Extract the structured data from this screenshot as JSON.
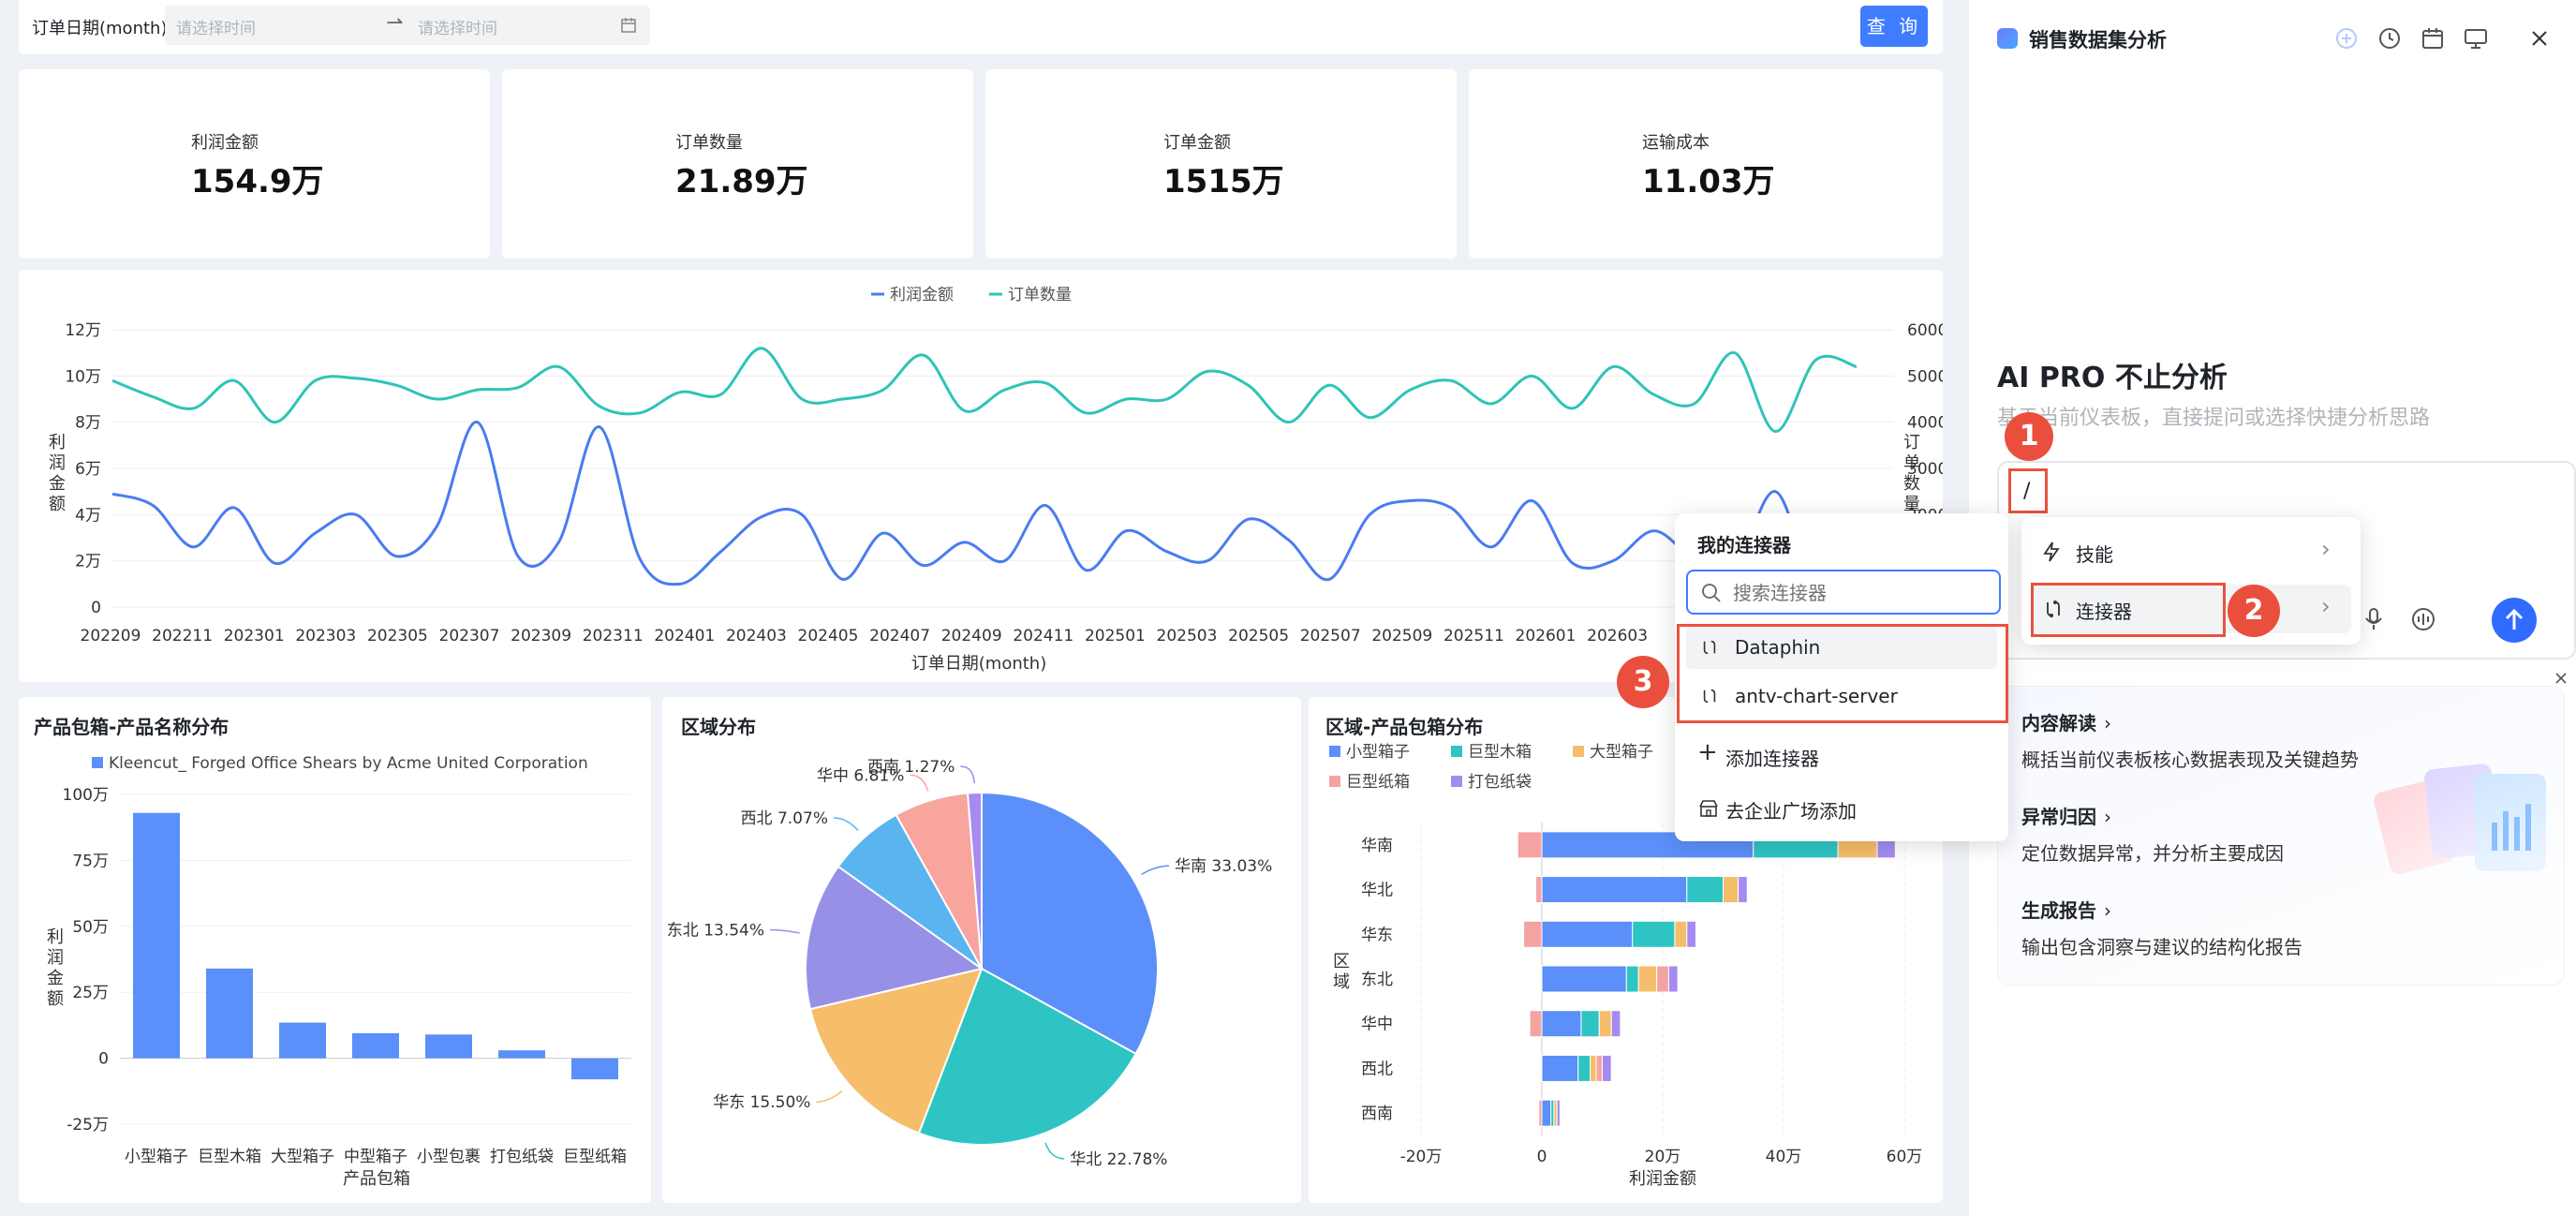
{
  "filter": {
    "label": "订单日期(month)",
    "start_placeholder": "请选择时间",
    "end_placeholder": "请选择时间",
    "query_label": "查 询"
  },
  "kpis": [
    {
      "label": "利润金额",
      "value": "154.9万"
    },
    {
      "label": "订单数量",
      "value": "21.89万"
    },
    {
      "label": "订单金额",
      "value": "1515万"
    },
    {
      "label": "运输成本",
      "value": "11.03万"
    }
  ],
  "line_chart": {
    "legend": [
      "利润金额",
      "订单数量"
    ],
    "y_left_ticks": [
      "12万",
      "10万",
      "8万",
      "6万",
      "4万",
      "2万",
      "0"
    ],
    "y_right_ticks": [
      "6000",
      "5000",
      "4000",
      "3000",
      "2000"
    ],
    "y_left_title": "利润金额",
    "y_right_title": "订单数量",
    "x_title": "订单日期(month)",
    "x_ticks": [
      "202209",
      "202211",
      "202301",
      "202303",
      "202305",
      "202307",
      "202309",
      "202311",
      "202401",
      "202403",
      "202405",
      "202407",
      "202409",
      "202411",
      "202501",
      "202503",
      "202505",
      "202507",
      "202509",
      "202511",
      "202601",
      "202603"
    ]
  },
  "bar_chart": {
    "title": "产品包箱-产品名称分布",
    "legend": "Kleencut_ Forged Office Shears by Acme United Corporation",
    "y_ticks": [
      "100万",
      "75万",
      "50万",
      "25万",
      "0",
      "-25万"
    ],
    "y_title": "利润金额",
    "x_title": "产品包箱"
  },
  "pie_chart": {
    "title": "区域分布"
  },
  "hbar_chart": {
    "title": "区域-产品包箱分布",
    "legend": [
      {
        "name": "小型箱子",
        "color": "#5b8ff9"
      },
      {
        "name": "巨型木箱",
        "color": "#2ec4c4"
      },
      {
        "name": "大型箱子",
        "color": "#f6bd6a"
      },
      {
        "name": "巨型纸箱",
        "color": "#f4a3a3"
      },
      {
        "name": "打包纸袋",
        "color": "#a58bf0"
      }
    ],
    "y_title": "区域",
    "x_title": "利润金额",
    "x_ticks": [
      "-20万",
      "0",
      "20万",
      "40万",
      "60万"
    ]
  },
  "chart_data": [
    {
      "type": "line",
      "x": [
        "202209",
        "202210",
        "202211",
        "202212",
        "202301",
        "202302",
        "202303",
        "202304",
        "202305",
        "202306",
        "202307",
        "202308",
        "202309",
        "202310",
        "202311",
        "202312",
        "202401",
        "202402",
        "202403",
        "202404",
        "202405",
        "202406",
        "202407",
        "202408",
        "202409",
        "202410",
        "202411",
        "202412",
        "202501",
        "202502",
        "202503",
        "202504",
        "202505",
        "202506",
        "202507",
        "202508",
        "202509",
        "202510",
        "202511",
        "202512",
        "202601",
        "202602",
        "202603",
        "202604"
      ],
      "series": [
        {
          "name": "利润金额",
          "axis": "left",
          "color": "#4a7cf0",
          "values": [
            4.9,
            4.4,
            2.6,
            4.3,
            1.9,
            3.2,
            4.0,
            2.2,
            3.5,
            8.0,
            2.2,
            2.8,
            7.8,
            2.1,
            1.0,
            2.4,
            3.9,
            4.0,
            1.2,
            3.2,
            1.8,
            2.8,
            2.0,
            4.4,
            1.6,
            3.3,
            2.4,
            2.0,
            3.8,
            2.9,
            1.2,
            4.0,
            4.6,
            4.3,
            2.6,
            4.6,
            1.9,
            2.0,
            3.3,
            2.1,
            1.8,
            5.0,
            1.0,
            3.0
          ]
        },
        {
          "name": "订单数量",
          "axis": "right",
          "color": "#2ec4b6",
          "values": [
            4900,
            4550,
            4300,
            4900,
            4000,
            4900,
            4950,
            4800,
            4500,
            4700,
            4750,
            5200,
            4350,
            4200,
            4650,
            4600,
            5600,
            4500,
            4500,
            4700,
            5450,
            4250,
            4700,
            4850,
            4200,
            4500,
            4500,
            5100,
            4800,
            4000,
            4800,
            4100,
            4700,
            4900,
            4400,
            5000,
            4300,
            5200,
            4600,
            4400,
            5500,
            3800,
            5350,
            5200
          ]
        }
      ],
      "ylim_left": [
        0,
        120000
      ],
      "ylim_right": [
        2000,
        6000
      ]
    },
    {
      "type": "bar",
      "categories": [
        "小型箱子",
        "巨型木箱",
        "大型箱子",
        "中型箱子",
        "小型包裹",
        "打包纸袋",
        "巨型纸箱"
      ],
      "series": [
        {
          "name": "Kleencut_ Forged Office Shears by Acme United Corporation",
          "values": [
            93,
            34,
            13.5,
            9.5,
            9,
            3,
            -8
          ]
        }
      ],
      "ylabel": "利润金额",
      "xlabel": "产品包箱",
      "ylim": [
        -25,
        100
      ],
      "unit": "万"
    },
    {
      "type": "pie",
      "slices": [
        {
          "label": "华南",
          "value": 33.03,
          "color": "#5b8ff9"
        },
        {
          "label": "华北",
          "value": 22.78,
          "color": "#2ec4c4"
        },
        {
          "label": "华东",
          "value": 15.5,
          "color": "#f6bd6a"
        },
        {
          "label": "东北",
          "value": 13.54,
          "color": "#9691e7"
        },
        {
          "label": "西北",
          "value": 7.07,
          "color": "#5ab4f0"
        },
        {
          "label": "华中",
          "value": 6.81,
          "color": "#f7a59d"
        },
        {
          "label": "西南",
          "value": 1.27,
          "color": "#a58bf0"
        }
      ]
    },
    {
      "type": "bar",
      "orientation": "horizontal",
      "stacked": true,
      "categories": [
        "华南",
        "华北",
        "华东",
        "东北",
        "华中",
        "西北",
        "西南"
      ],
      "series": [
        {
          "name": "小型箱子",
          "values": [
            35,
            24,
            15,
            14,
            6.5,
            6,
            1.5
          ]
        },
        {
          "name": "巨型木箱",
          "values": [
            14,
            6,
            7,
            2,
            3,
            2,
            0.5
          ]
        },
        {
          "name": "大型箱子",
          "values": [
            6.5,
            2.5,
            2,
            3,
            2,
            1,
            0.5
          ]
        },
        {
          "name": "巨型纸箱",
          "values": [
            -4,
            -1,
            -3,
            2,
            -2,
            1,
            -0.5
          ]
        },
        {
          "name": "打包纸袋",
          "values": [
            3,
            1.5,
            1.5,
            1.5,
            1.5,
            1.5,
            0.5
          ]
        }
      ],
      "xlabel": "利润金额",
      "ylabel": "区域",
      "xlim": [
        -20,
        60
      ],
      "unit": "万"
    }
  ],
  "ai_panel": {
    "title": "销售数据集分析",
    "headline": "AI PRO 不止分析",
    "subtitle": "基于当前仪表板，直接提问或选择快捷分析思路",
    "input_value": "/",
    "menu": [
      {
        "label": "技能"
      },
      {
        "label": "连接器"
      }
    ],
    "quick": [
      {
        "title": "内容解读",
        "desc": "概括当前仪表板核心数据表现及关键趋势"
      },
      {
        "title": "异常归因",
        "desc": "定位数据异常，并分析主要成因"
      },
      {
        "title": "生成报告",
        "desc": "输出包含洞察与建议的结构化报告"
      }
    ]
  },
  "connector_dropdown": {
    "title": "我的连接器",
    "search_placeholder": "搜索连接器",
    "items": [
      "Dataphin",
      "antv-chart-server"
    ],
    "add_label": "添加连接器",
    "market_label": "去企业广场添加"
  },
  "markers": [
    "1",
    "2",
    "3"
  ]
}
